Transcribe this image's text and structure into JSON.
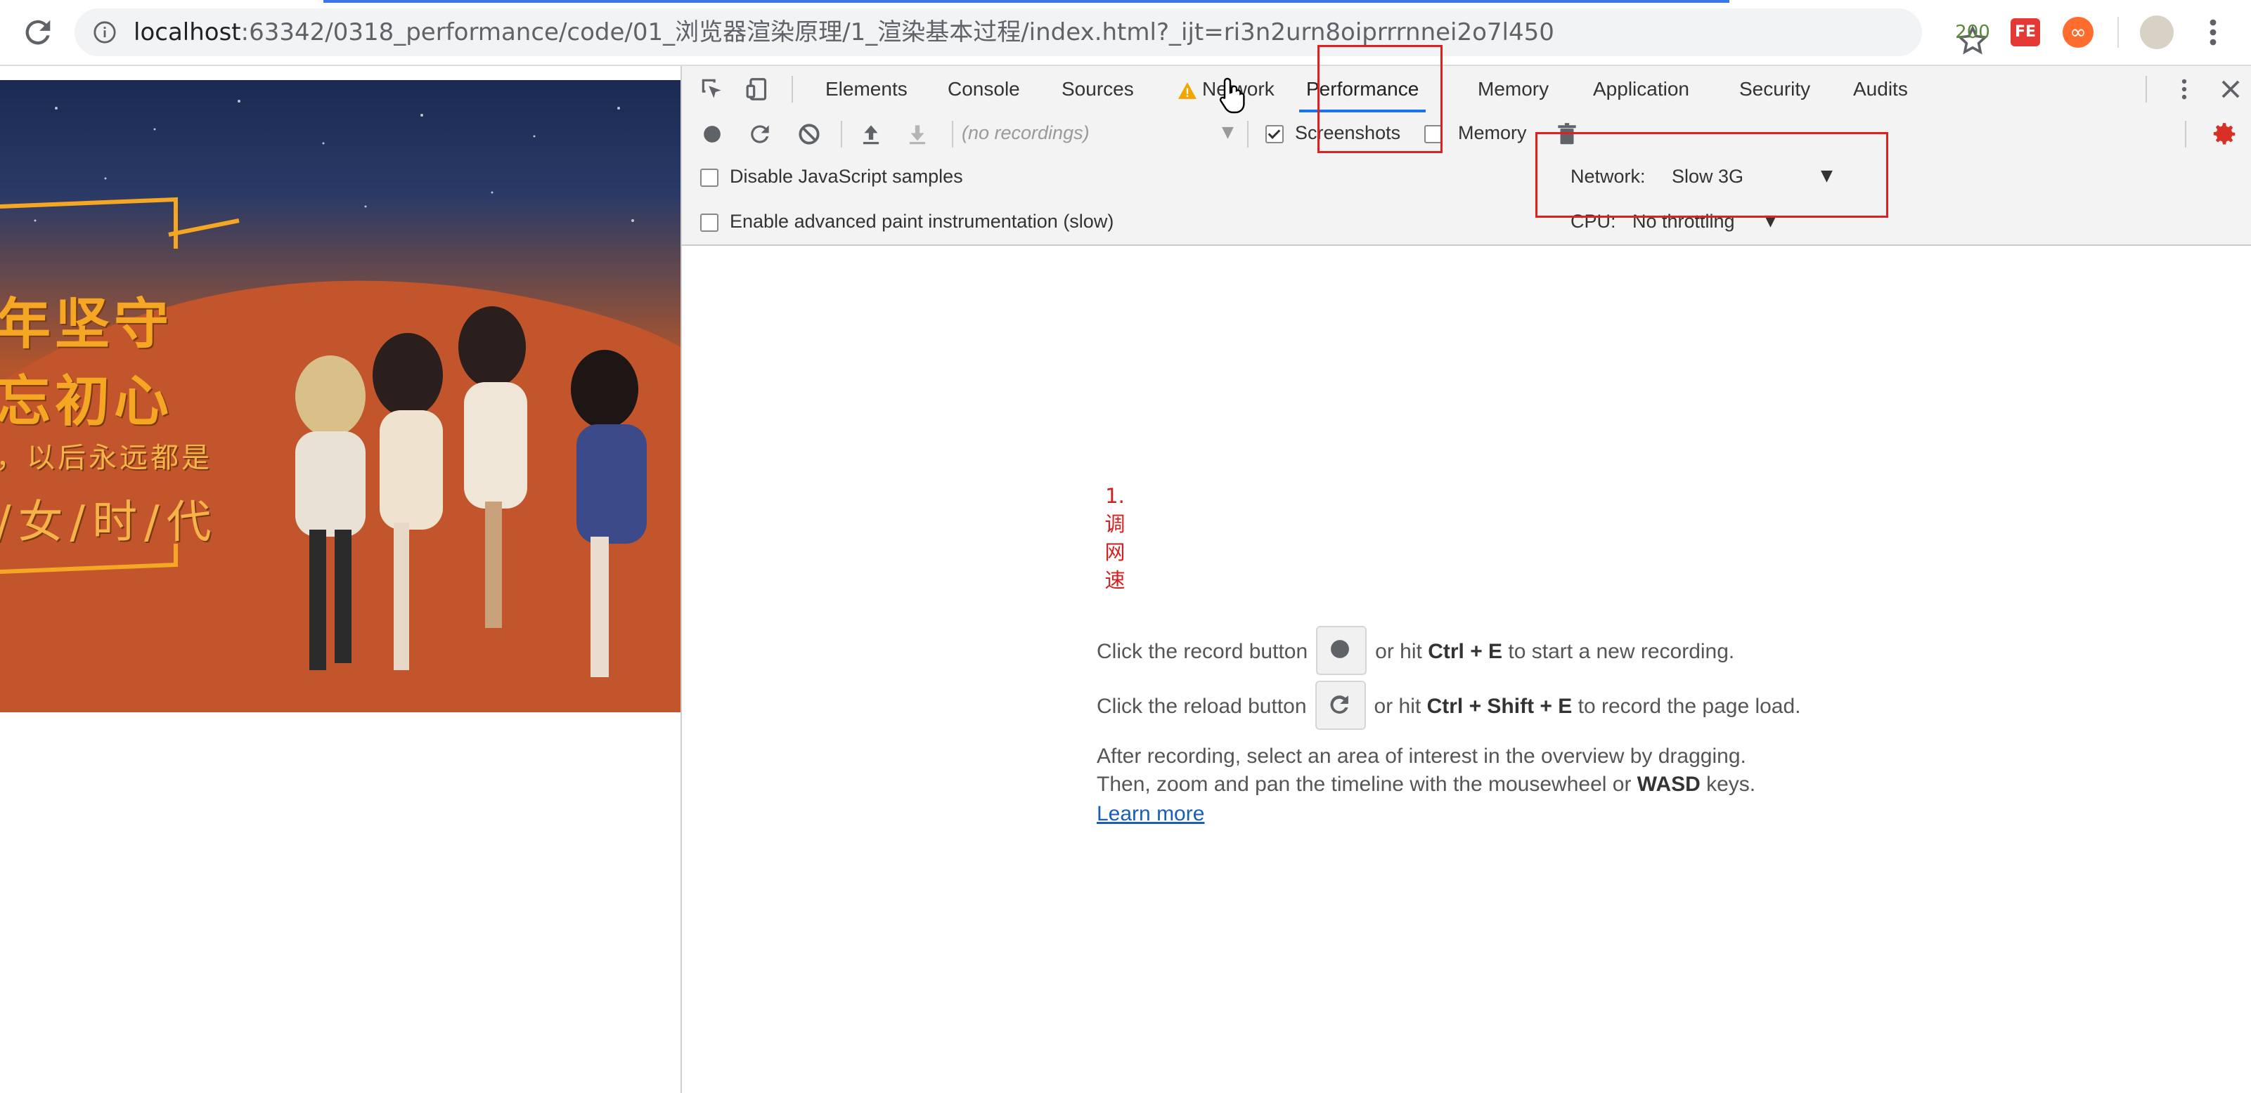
{
  "browser": {
    "url_host": "localhost",
    "url_rest": ":63342/0318_performance/code/01_浏览器渲染原理/1_渲染基本过程/index.html?_ijt=ri3n2urn8oiprrrnnei2o7l450",
    "extensions": {
      "counter": "200",
      "fe": "FE",
      "infinity": "∞"
    }
  },
  "banner": {
    "line1": "年坚守",
    "line2": "忘初心",
    "line3": "，以后永远都是",
    "line4": "/女/时/代"
  },
  "devtools": {
    "tabs": [
      {
        "label": "Elements"
      },
      {
        "label": "Console"
      },
      {
        "label": "Sources"
      },
      {
        "label": "Network"
      },
      {
        "label": "Performance"
      },
      {
        "label": "Memory"
      },
      {
        "label": "Application"
      },
      {
        "label": "Security"
      },
      {
        "label": "Audits"
      }
    ],
    "active_tab": "Performance",
    "toolbar": {
      "recordings_placeholder": "(no recordings)",
      "screenshots_label": "Screenshots",
      "screenshots_checked": true,
      "memory_label": "Memory",
      "memory_checked": false
    },
    "settings": {
      "disable_js_samples": "Disable JavaScript samples",
      "enable_paint": "Enable advanced paint instrumentation (slow)",
      "network_label": "Network:",
      "network_value": "Slow 3G",
      "cpu_label": "CPU:",
      "cpu_value": "No throttling"
    },
    "landing": {
      "record_prefix": "Click the record button",
      "record_middle": "or hit",
      "record_keys": "Ctrl + E",
      "record_suffix": "to start a new recording.",
      "reload_prefix": "Click the reload button",
      "reload_middle": "or hit",
      "reload_keys": "Ctrl + Shift + E",
      "reload_suffix": "to record the page load.",
      "after_line1": "After recording, select an area of interest in the overview by dragging.",
      "after_line2_prefix": "Then, zoom and pan the timeline with the mousewheel or",
      "after_line2_keys": "WASD",
      "after_line2_suffix": "keys.",
      "learn_more": "Learn more"
    },
    "annotation": {
      "num": "1.",
      "c1": "调",
      "c2": "网",
      "c3": "速"
    }
  },
  "colors": {
    "accent_blue": "#1a73e8",
    "annotation_red": "#e02020",
    "record_settings_red": "#d93025"
  }
}
